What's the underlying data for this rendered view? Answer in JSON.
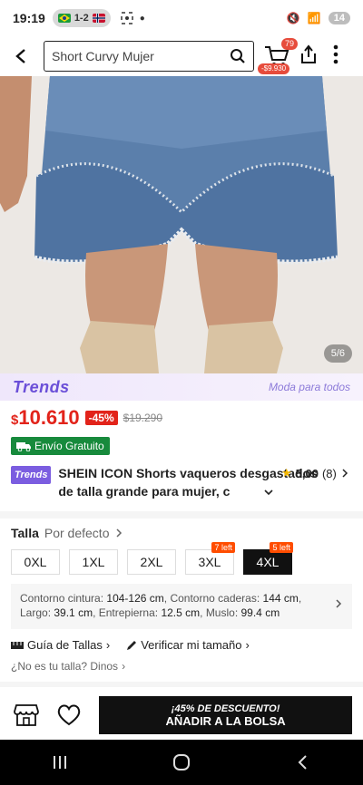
{
  "status": {
    "time": "19:19",
    "sim_label": "1-2",
    "battery": "14"
  },
  "search": {
    "query": "Short Curvy Mujer"
  },
  "cart": {
    "count": "79",
    "price": "-$9.930"
  },
  "gallery": {
    "counter": "5/6"
  },
  "trends": {
    "logo": "Trends",
    "tagline": "Moda para todos"
  },
  "price": {
    "currency": "$",
    "value": "10.610",
    "discount": "-45%",
    "original": "$19.290"
  },
  "shipping": {
    "label": "Envío Gratuito"
  },
  "product": {
    "chip": "Trends",
    "title": "SHEIN ICON Shorts vaqueros desgastados de talla grande para mujer, c",
    "rating": "5,00",
    "reviews": "(8)"
  },
  "size": {
    "label": "Talla",
    "sort": "Por defecto",
    "options": [
      {
        "label": "0XL",
        "badge": ""
      },
      {
        "label": "1XL",
        "badge": ""
      },
      {
        "label": "2XL",
        "badge": ""
      },
      {
        "label": "3XL",
        "badge": "7 left"
      },
      {
        "label": "4XL",
        "badge": "5 left"
      }
    ],
    "selected": "4XL"
  },
  "measure": {
    "waist_label": "Contorno cintura:",
    "waist": "104-126 cm",
    "hip_label": "Contorno caderas:",
    "hip": "144 cm",
    "length_label": "Largo:",
    "length": "39.1 cm",
    "inseam_label": "Entrepierna:",
    "inseam": "12.5 cm",
    "thigh_label": "Muslo:",
    "thigh": "99.4 cm"
  },
  "links": {
    "guide": "Guía de Tallas",
    "verify": "Verificar mi tamaño",
    "nofit": "¿No es tu talla? Dinos"
  },
  "cta": {
    "promo": "¡45% DE DESCUENTO!",
    "main": "AÑADIR A LA BOLSA"
  },
  "colors": {
    "accent": "#e2231a",
    "trends": "#6b4fd8",
    "shipping": "#178a3c",
    "badge": "#ff4d00"
  }
}
